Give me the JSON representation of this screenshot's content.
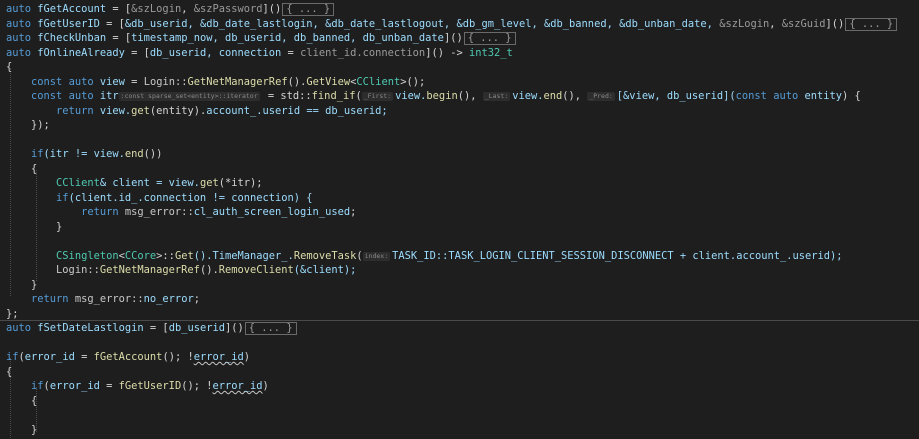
{
  "colors": {
    "background": "#1e1e1e",
    "keyword": "#569cd6",
    "variable": "#9cdcfe",
    "function": "#dcdcaa",
    "type": "#4ec9b0",
    "text": "#d4d4d4"
  },
  "folds": {
    "collapsed_label": "{ ... }"
  },
  "code": {
    "kw_auto": "auto",
    "kw_const": "const",
    "kw_return": "return",
    "kw_if": "if",
    "l1_name": "fGetAccount",
    "l1_eq": " = [",
    "l1_cap1": "&szLogin",
    "l1_c": ", ",
    "l1_cap2": "&szPassword",
    "l1_end": "]()",
    "l2_name": "fGetUserID",
    "l2_eq": " = [",
    "l2_caps": "&db_userid, &db_date_lastlogin, &db_date_lastlogout, &db_gm_level, &db_banned, &db_unban_date, ",
    "l2_cap_a": "&szLogin",
    "l2_c": ", ",
    "l2_cap_b": "&szGuid",
    "l2_end": "]()",
    "l3_name": "fCheckUnban",
    "l3_eq": " = [",
    "l3_caps": "timestamp_now, db_userid, db_banned, db_unban_date",
    "l3_end": "]()",
    "l4_name": "fOnlineAlready",
    "l4_eq": " = [",
    "l4_caps": "db_userid, connection",
    "l4_eq2": " = ",
    "l4_init": "client_id.connection",
    "l4_end": "]() -> ",
    "l4_ret": "int32_t",
    "l5": "{",
    "l6_view": "view",
    "l6_eq": " = ",
    "l6_ns": "Login::",
    "l6_fn1": "GetNetManagerRef",
    "l6_p1": "().",
    "l6_fn2": "GetView",
    "l6_lt": "<",
    "l6_type": "CClient",
    "l6_gt": ">();",
    "l7_itr": "itr",
    "l7_hint": ":const sparse_set<entity>::iterator",
    "l7_eq": " = std::",
    "l7_fn": "find_if",
    "l7_paren": "(",
    "l7_hint_first": "_First:",
    "l7_a1": "view.",
    "l7_begin": "begin",
    "l7_a1e": "(), ",
    "l7_hint_last": "_Last:",
    "l7_a2": "view.",
    "l7_end": "end",
    "l7_a2e": "(), ",
    "l7_hint_pred": "_Pred:",
    "l7_lam": "[&view, db_userid](",
    "l7_const": "const",
    "l7_sp": " ",
    "l7_auto": "auto",
    "l7_entity": " entity",
    "l7_close": ") {",
    "l8_expr": " view.",
    "l8_get": "get",
    "l8_arg": "(entity).",
    "l8_rest": "account_.userid == db_userid;",
    "l9": "});",
    "l10": "",
    "l11_cond": "(itr != view.",
    "l11_end": "end",
    "l11_close": "())",
    "l12": "{",
    "l13_type": "CClient",
    "l13_decl": "& client = view.",
    "l13_get": "get",
    "l13_arg": "(*itr);",
    "l14_cond": "(client.id_.connection != connection) {",
    "l15_ns": " msg_error::",
    "l15_val": "cl_auth_screen_login_used",
    "l15_semi": ";",
    "l16": "}",
    "l17": "",
    "l18_type1": "CSingleton",
    "l18_lt": "<",
    "l18_type2": "CCore",
    "l18_gt": ">::",
    "l18_fn1": "Get",
    "l18_p1": "().TimeManager_.",
    "l18_fn2": "RemoveTask",
    "l18_paren": "(",
    "l18_hint": "index:",
    "l18_arg": "TASK_ID::TASK_LOGIN_CLIENT_SESSION_DISCONNECT + client.account_.userid);",
    "l19_ns": "Login::",
    "l19_fn1": "GetNetManagerRef",
    "l19_p1": "().",
    "l19_fn2": "RemoveClient",
    "l19_arg": "(&client);",
    "l20": "}",
    "l21_ns": " msg_error::",
    "l21_val": "no_error",
    "l21_semi": ";",
    "l22": "};",
    "l23_name": "fSetDateLastlogin",
    "l23_eq": " = [",
    "l23_caps": "db_userid",
    "l23_end": "]()",
    "l24": "",
    "l25_kw": "if",
    "l25_open": "(",
    "l25_var": "error_id",
    "l25_eq": " = ",
    "l25_fn": "fGetAccount",
    "l25_mid": "(); !",
    "l25_err": "error_id",
    "l25_close": ")",
    "l26": "{",
    "l27_kw": "if",
    "l27_open": "(",
    "l27_var": "error_id",
    "l27_eq": " = ",
    "l27_fn": "fGetUserID",
    "l27_mid": "(); !",
    "l27_err": "error_id",
    "l27_close": ")",
    "l28": "{",
    "l29": "",
    "l30": "}"
  }
}
